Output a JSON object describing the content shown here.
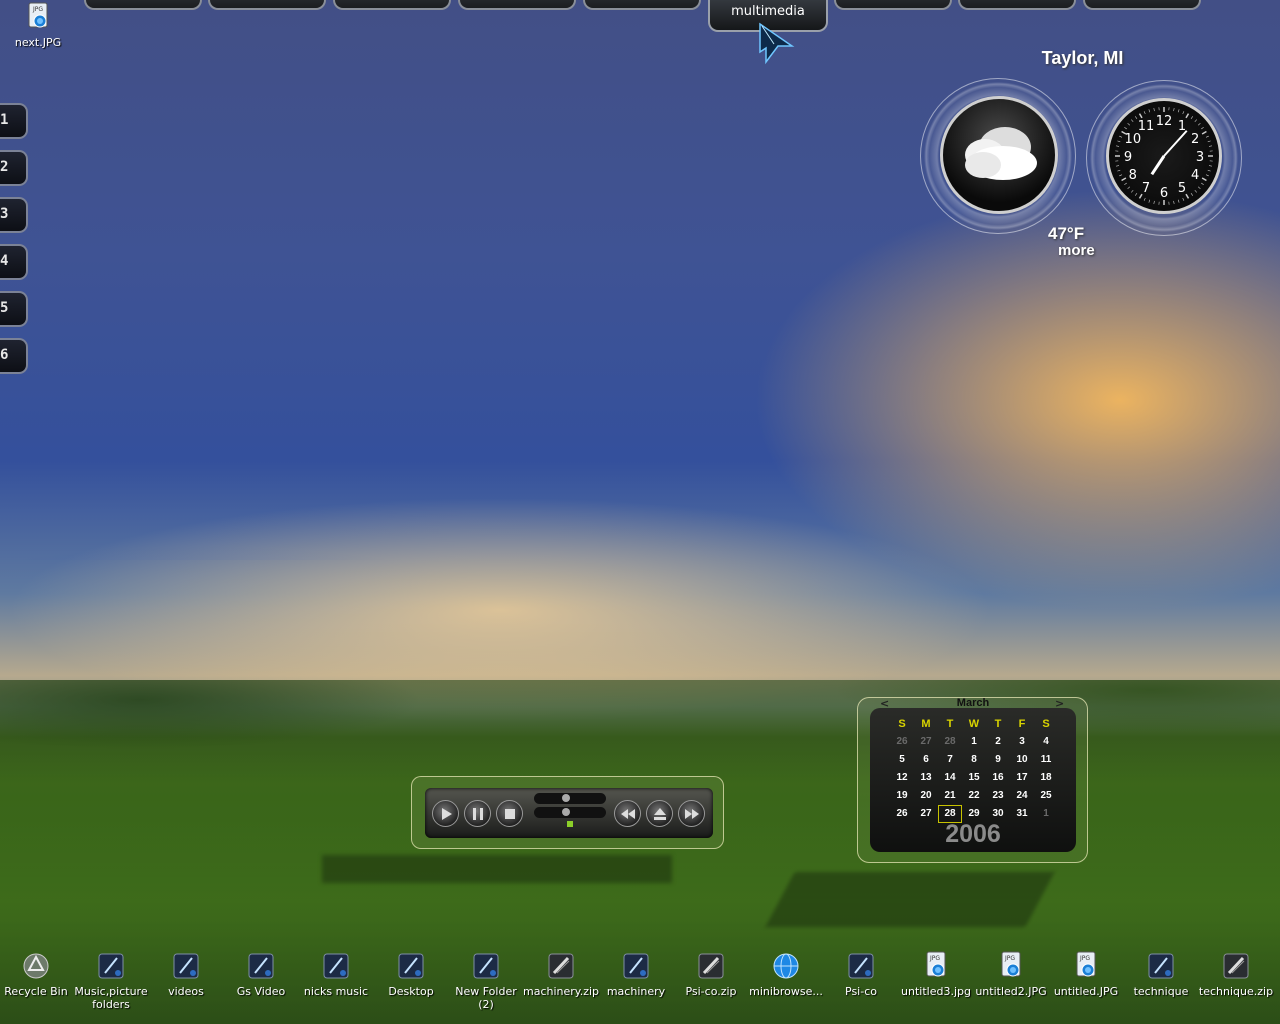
{
  "top_tabs": {
    "active_label": "multimedia"
  },
  "side_tabs": [
    "1",
    "2",
    "3",
    "4",
    "5",
    "6"
  ],
  "top_left_icon": {
    "label": "next.JPG",
    "icon": "jpg-file-icon"
  },
  "weather": {
    "city": "Taylor, MI",
    "temperature": "47°F",
    "more": "more",
    "condition_icon": "cloudy-icon"
  },
  "clock": {
    "hour": 7,
    "minute": 7
  },
  "media_player": {
    "buttons": [
      "play",
      "pause",
      "stop",
      "rewind",
      "eject",
      "fast-forward"
    ]
  },
  "calendar": {
    "month": "March",
    "year": "2006",
    "prev": "<",
    "next": ">",
    "weekdays": [
      "S",
      "M",
      "T",
      "W",
      "T",
      "F",
      "S"
    ],
    "weeks": [
      [
        "26",
        "27",
        "28",
        "1",
        "2",
        "3",
        "4"
      ],
      [
        "5",
        "6",
        "7",
        "8",
        "9",
        "10",
        "11"
      ],
      [
        "12",
        "13",
        "14",
        "15",
        "16",
        "17",
        "18"
      ],
      [
        "19",
        "20",
        "21",
        "22",
        "23",
        "24",
        "25"
      ],
      [
        "26",
        "27",
        "28",
        "29",
        "30",
        "31",
        "1"
      ]
    ],
    "today": "28",
    "accent": "#d9d400"
  },
  "taskbar_icons": [
    {
      "label": "Recycle Bin",
      "icon": "recycle-bin-icon"
    },
    {
      "label": "Music,picture folders",
      "icon": "folder-shortcut-icon"
    },
    {
      "label": "videos",
      "icon": "folder-shortcut-icon"
    },
    {
      "label": "Gs Video",
      "icon": "folder-shortcut-icon"
    },
    {
      "label": "nicks music",
      "icon": "folder-shortcut-icon"
    },
    {
      "label": "Desktop",
      "icon": "folder-shortcut-icon"
    },
    {
      "label": "New Folder (2)",
      "icon": "folder-shortcut-icon"
    },
    {
      "label": "machinery.zip",
      "icon": "zip-file-icon"
    },
    {
      "label": "machinery",
      "icon": "folder-shortcut-icon"
    },
    {
      "label": "Psi-co.zip",
      "icon": "zip-file-icon"
    },
    {
      "label": "minibrowse...",
      "icon": "globe-icon"
    },
    {
      "label": "Psi-co",
      "icon": "folder-shortcut-icon"
    },
    {
      "label": "untitled3.jpg",
      "icon": "jpg-file-icon"
    },
    {
      "label": "untitled2.JPG",
      "icon": "jpg-file-icon"
    },
    {
      "label": "untitled.JPG",
      "icon": "jpg-file-icon"
    },
    {
      "label": "technique",
      "icon": "folder-shortcut-icon"
    },
    {
      "label": "technique.zip",
      "icon": "zip-file-icon"
    }
  ]
}
